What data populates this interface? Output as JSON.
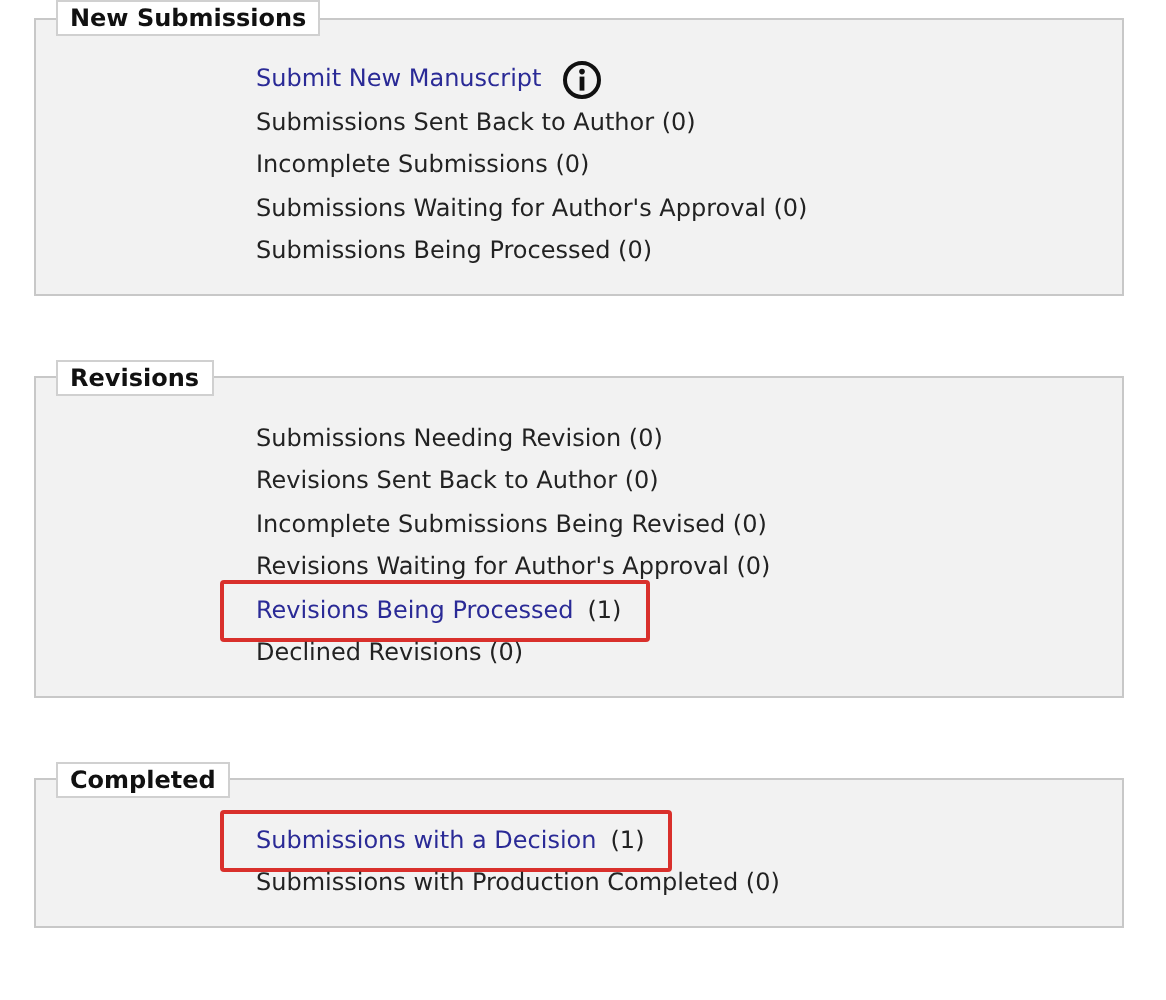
{
  "sections": [
    {
      "title": "New Submissions",
      "items": [
        {
          "kind": "link",
          "label": "Submit New Manuscript",
          "info": true,
          "highlighted": false
        },
        {
          "kind": "text",
          "label": "Submissions Sent Back to Author (0)",
          "highlighted": false
        },
        {
          "kind": "text",
          "label": "Incomplete Submissions (0)",
          "highlighted": false
        },
        {
          "kind": "text",
          "label": "Submissions Waiting for Author's Approval (0)",
          "highlighted": false
        },
        {
          "kind": "text",
          "label": "Submissions Being Processed (0)",
          "highlighted": false
        }
      ]
    },
    {
      "title": "Revisions",
      "items": [
        {
          "kind": "text",
          "label": "Submissions Needing Revision (0)",
          "highlighted": false
        },
        {
          "kind": "text",
          "label": "Revisions Sent Back to Author (0)",
          "highlighted": false
        },
        {
          "kind": "text",
          "label": "Incomplete Submissions Being Revised (0)",
          "highlighted": false
        },
        {
          "kind": "text",
          "label": "Revisions Waiting for Author's Approval (0)",
          "highlighted": false
        },
        {
          "kind": "link",
          "label": "Revisions Being Processed",
          "count": "(1)",
          "info": false,
          "highlighted": true
        },
        {
          "kind": "text",
          "label": "Declined Revisions (0)",
          "highlighted": false
        }
      ]
    },
    {
      "title": "Completed",
      "items": [
        {
          "kind": "link",
          "label": "Submissions with a Decision",
          "count": "(1)",
          "info": false,
          "highlighted": true
        },
        {
          "kind": "text",
          "label": "Submissions with Production Completed (0)",
          "highlighted": false
        }
      ]
    }
  ]
}
